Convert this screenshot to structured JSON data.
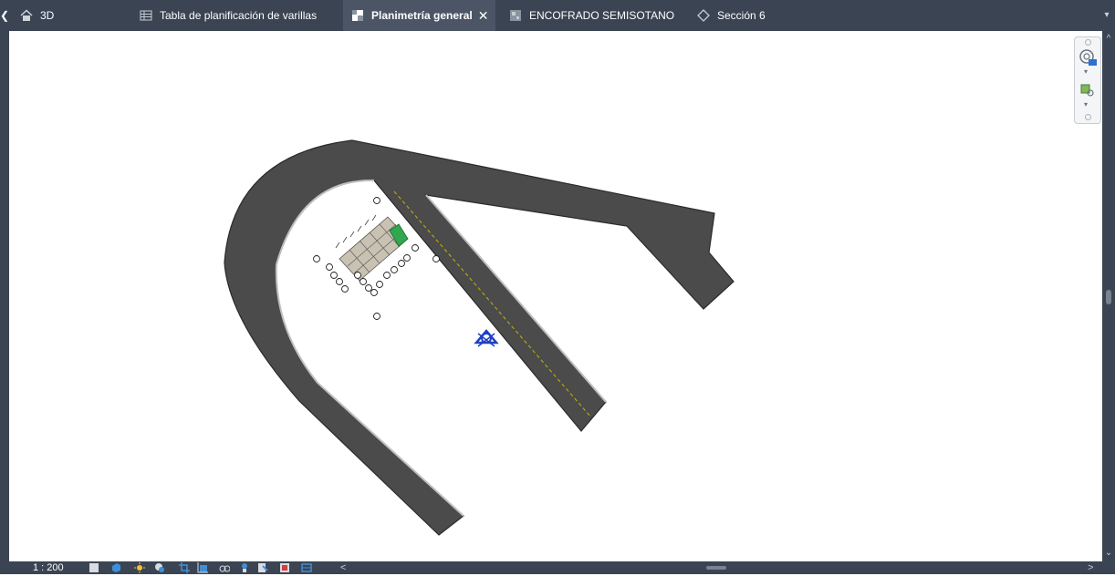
{
  "tabs": [
    {
      "label": "3D",
      "icon": "house-icon",
      "active": false
    },
    {
      "label": "Tabla de planificación de varillas",
      "icon": "table-icon",
      "active": false
    },
    {
      "label": "Planimetría general",
      "icon": "sheet-icon",
      "active": true
    },
    {
      "label": "ENCOFRADO SEMISOTANO",
      "icon": "plan-icon",
      "active": false
    },
    {
      "label": "Sección 6",
      "icon": "section-icon",
      "active": false
    }
  ],
  "status_bar": {
    "scale": "1 : 200"
  },
  "colors": {
    "chrome": "#3b4453",
    "active_tab": "#4b5565",
    "road_fill": "#4b4b4b",
    "component_green": "#2fa84f",
    "marker_blue": "#1f3fc4"
  }
}
